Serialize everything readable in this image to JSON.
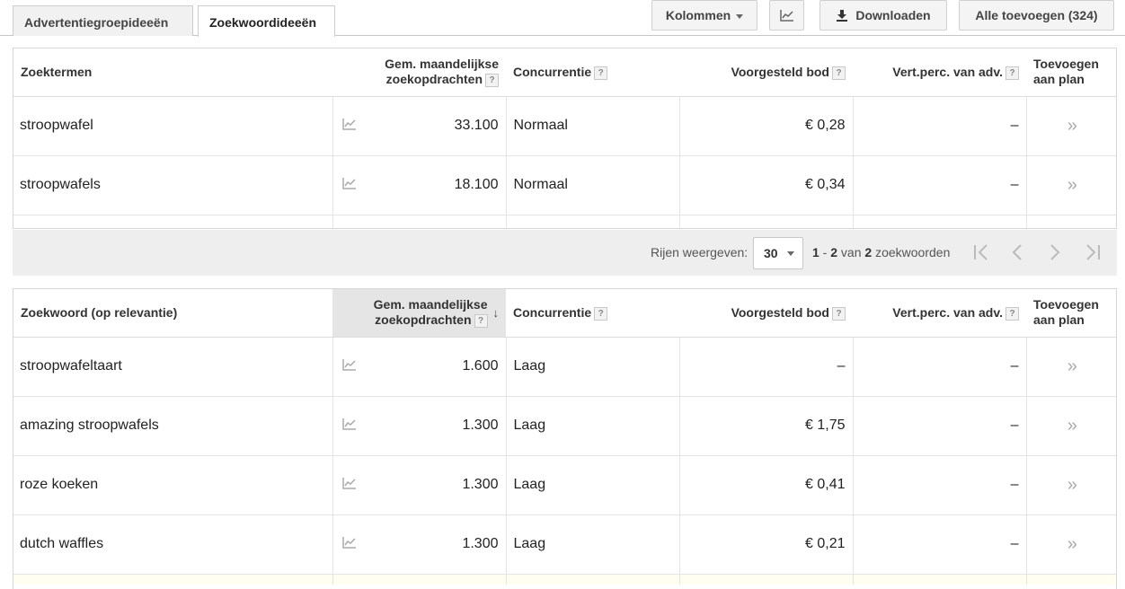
{
  "tabs": [
    {
      "label": "Advertentiegroepideeën"
    },
    {
      "label": "Zoekwoordideeën"
    }
  ],
  "toolbar": {
    "columns_label": "Kolommen",
    "download_label": "Downloaden",
    "add_all_label": "Alle toevoegen (324)",
    "chart_icon": "line-chart-icon"
  },
  "table1": {
    "headers": {
      "term": "Zoektermen",
      "monthly": "Gem. maandelijkse zoekopdrachten",
      "competition": "Concurrentie",
      "bid": "Voorgesteld bod",
      "share": "Vert.perc. van adv.",
      "add": "Toevoegen aan plan"
    },
    "rows": [
      {
        "term": "stroopwafel",
        "monthly": "33.100",
        "competition": "Normaal",
        "bid": "€ 0,28",
        "share": "–",
        "add": "»"
      },
      {
        "term": "stroopwafels",
        "monthly": "18.100",
        "competition": "Normaal",
        "bid": "€ 0,34",
        "share": "–",
        "add": "»"
      }
    ]
  },
  "pagination": {
    "rows_label": "Rijen weergeven:",
    "rows_value": "30",
    "range_start": "1",
    "range_sep": " - ",
    "range_end": "2",
    "range_of": " van ",
    "range_total": "2",
    "range_unit": " zoekwoorden"
  },
  "table2": {
    "headers": {
      "term": "Zoekwoord (op relevantie)",
      "monthly": "Gem. maandelijkse zoekopdrachten",
      "competition": "Concurrentie",
      "bid": "Voorgesteld bod",
      "share": "Vert.perc. van adv.",
      "add": "Toevoegen aan plan"
    },
    "rows": [
      {
        "term": "stroopwafeltaart",
        "monthly": "1.600",
        "competition": "Laag",
        "bid": "–",
        "share": "–",
        "add": "»"
      },
      {
        "term": "amazing stroopwafels",
        "monthly": "1.300",
        "competition": "Laag",
        "bid": "€ 1,75",
        "share": "–",
        "add": "»"
      },
      {
        "term": "roze koeken",
        "monthly": "1.300",
        "competition": "Laag",
        "bid": "€ 0,41",
        "share": "–",
        "add": "»"
      },
      {
        "term": "dutch waffles",
        "monthly": "1.300",
        "competition": "Laag",
        "bid": "€ 0,21",
        "share": "–",
        "add": "»"
      }
    ]
  },
  "colors": {
    "header_bg": "#ffffff",
    "sorted_header_bg": "#e5e5e5",
    "pager_bg": "#eeeeee",
    "highlight_row": "#fffef0"
  }
}
